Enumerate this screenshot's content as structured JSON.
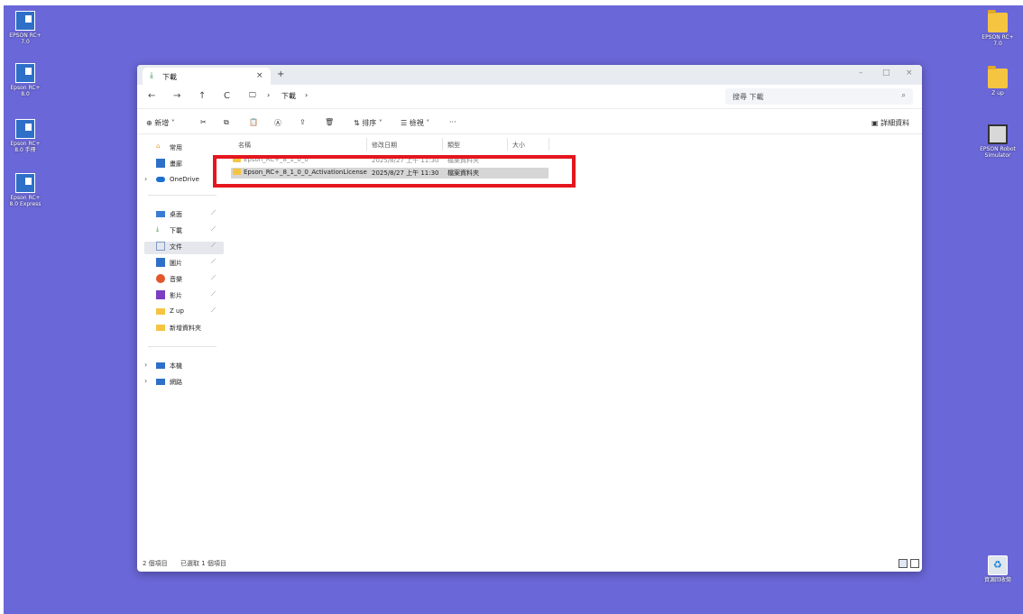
{
  "desktop": {
    "icons_left": [
      {
        "label": "EPSON RC+ 7.0",
        "icon": "epson-rc-app-icon"
      },
      {
        "label": "Epson RC+ 8.0",
        "icon": "epson-rc-app-icon"
      },
      {
        "label": "Epson RC+ 8.0 手冊",
        "icon": "epson-manual-icon"
      },
      {
        "label": "Epson RC+ 8.0 Express",
        "icon": "epson-express-icon"
      }
    ],
    "icons_right": [
      {
        "label": "EPSON RC+ 7.0",
        "icon": "folder-icon"
      },
      {
        "label": "Z up",
        "icon": "folder-icon"
      },
      {
        "label": "EPSON Robot Simulator",
        "icon": "film-icon"
      },
      {
        "label": "資源回收筒",
        "icon": "recycle-bin-icon"
      }
    ],
    "colors": {
      "wallpaper": "#6A67D8",
      "highlight": "#E4161E"
    }
  },
  "window": {
    "tab": {
      "label": "下載",
      "close": "×",
      "new": "+"
    },
    "controls": {
      "minimize": "–",
      "maximize": "□",
      "close": "×"
    },
    "nav": {
      "back": "←",
      "forward": "→",
      "up": "↑",
      "refresh": "C"
    },
    "path": {
      "sep": "›",
      "folder": "下載"
    },
    "search": {
      "placeholder": "搜尋 下載",
      "icon": "⌕"
    },
    "commands": {
      "new": "新增",
      "sort": "排序",
      "view": "檢視",
      "more": "···",
      "details": "詳細資料"
    },
    "sidebar": {
      "top": [
        {
          "label": "常用",
          "icon": "home-icon",
          "color": "#E8A13A"
        },
        {
          "label": "畫廊",
          "icon": "gallery-icon",
          "color": "#2E6FC8"
        },
        {
          "label": "OneDrive",
          "icon": "onedrive-icon",
          "color": "#1A6FD0"
        }
      ],
      "quick": [
        {
          "label": "桌面",
          "icon": "desktop-icon",
          "color": "#3A7BD5",
          "pin": "📌"
        },
        {
          "label": "下載",
          "icon": "download-icon",
          "color": "#2A8A3A",
          "pin": "📌"
        },
        {
          "label": "文件",
          "icon": "documents-icon",
          "color": "#7A9AC8",
          "pin": "📌"
        },
        {
          "label": "圖片",
          "icon": "pictures-icon",
          "color": "#2E6FC8",
          "pin": "📌"
        },
        {
          "label": "音樂",
          "icon": "music-icon",
          "color": "#E2572C",
          "pin": "📌"
        },
        {
          "label": "影片",
          "icon": "videos-icon",
          "color": "#7B3FC4",
          "pin": "📌"
        },
        {
          "label": "Z up",
          "icon": "folder-icon",
          "color": "#F5C542",
          "pin": "📌"
        },
        {
          "label": "新增資料夾",
          "icon": "folder-icon",
          "color": "#F5C542",
          "pin": ""
        }
      ],
      "bottom": [
        {
          "label": "本機",
          "icon": "this-pc-icon",
          "color": "#2E6FC8"
        },
        {
          "label": "網路",
          "icon": "network-icon",
          "color": "#2E6FC8"
        }
      ]
    },
    "columns": {
      "name": "名稱",
      "date": "修改日期",
      "type": "類型",
      "size": "大小"
    },
    "files": [
      {
        "name": "Epson_RC+_8_1_0_0",
        "date": "2025/8/27 上午 11:30",
        "type": "檔案資料夾",
        "state": "faded"
      },
      {
        "name": "Epson_RC+_8_1_0_0_ActivationLicense",
        "date": "2025/8/27 上午 11:30",
        "type": "檔案資料夾",
        "state": "selected"
      }
    ],
    "status": {
      "count": "2 個項目",
      "selected": "已選取 1 個項目"
    }
  }
}
